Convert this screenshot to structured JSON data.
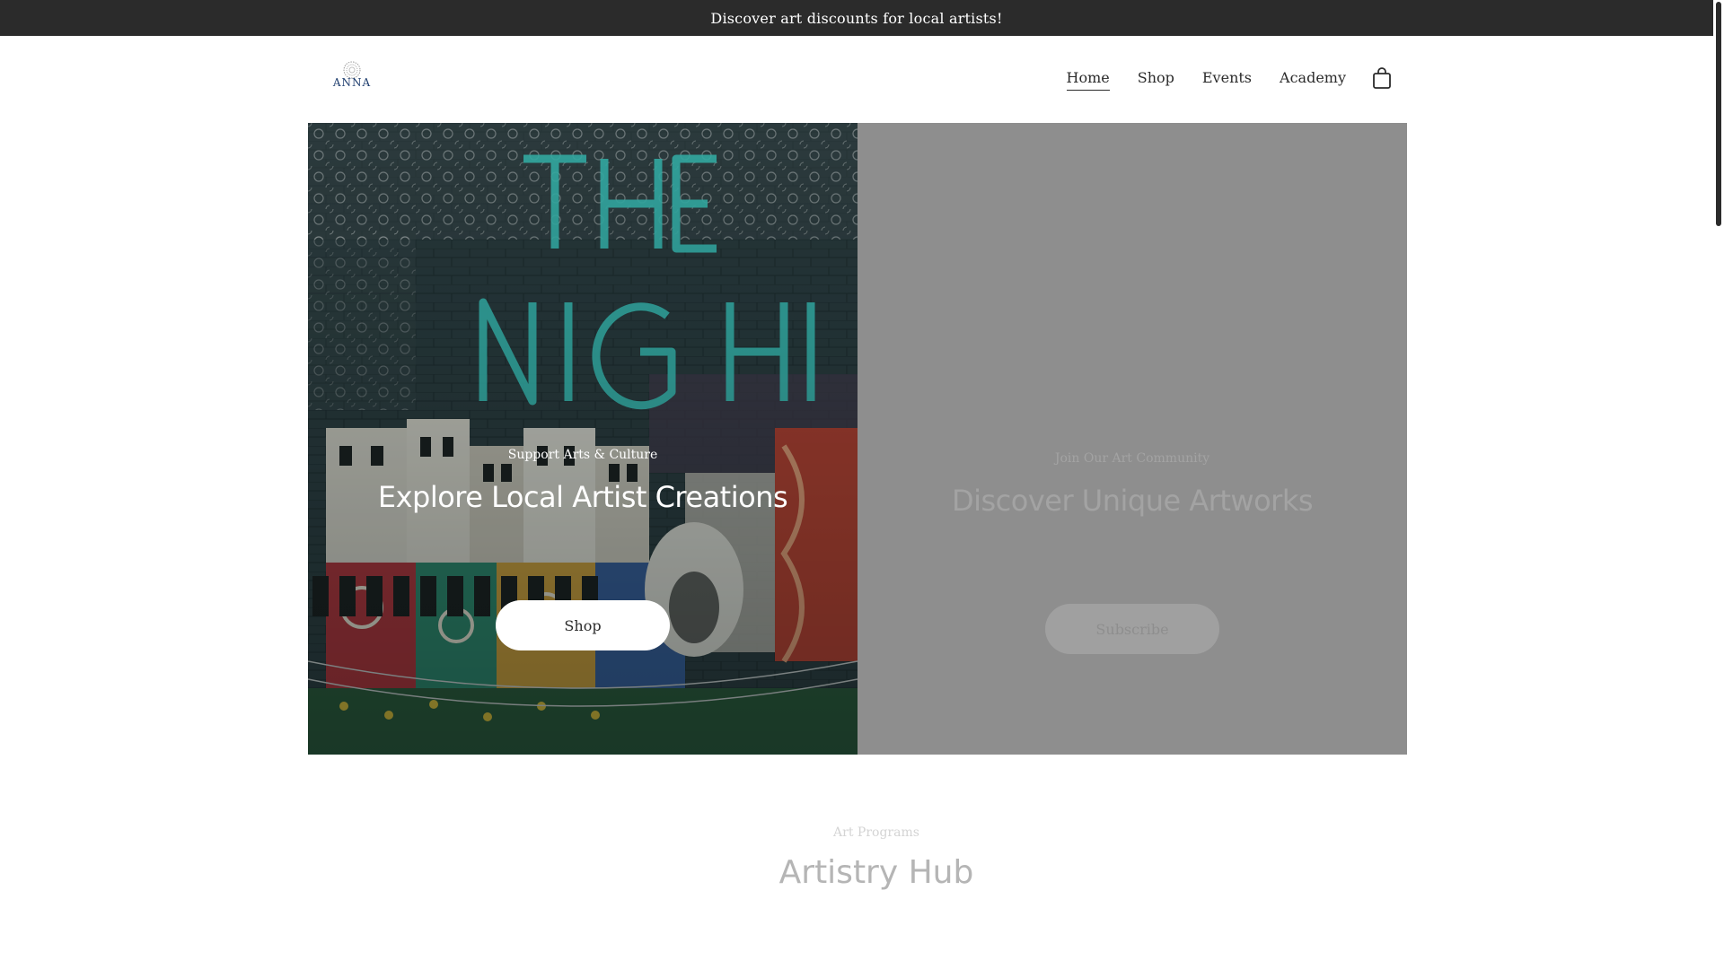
{
  "announcement": {
    "text": "Discover art discounts for local artists!"
  },
  "header": {
    "logo_text": "ANNA",
    "nav": [
      {
        "label": "Home",
        "active": true
      },
      {
        "label": "Shop",
        "active": false
      },
      {
        "label": "Events",
        "active": false
      },
      {
        "label": "Academy",
        "active": false
      }
    ],
    "cart_icon": "shopping-bag-icon"
  },
  "hero": {
    "left": {
      "eyebrow": "Support Arts & Culture",
      "headline": "Explore Local Artist Creations",
      "button_label": "Shop"
    },
    "right": {
      "eyebrow": "Join Our Art Community",
      "headline": "Discover Unique Artworks",
      "button_label": "Subscribe"
    }
  },
  "section": {
    "eyebrow": "Art Programs",
    "title": "Artistry Hub"
  },
  "colors": {
    "announcement_bg": "#2b2b2b",
    "panel_gray": "#8e8e8e",
    "accent_teal": "#3fd1c8"
  }
}
